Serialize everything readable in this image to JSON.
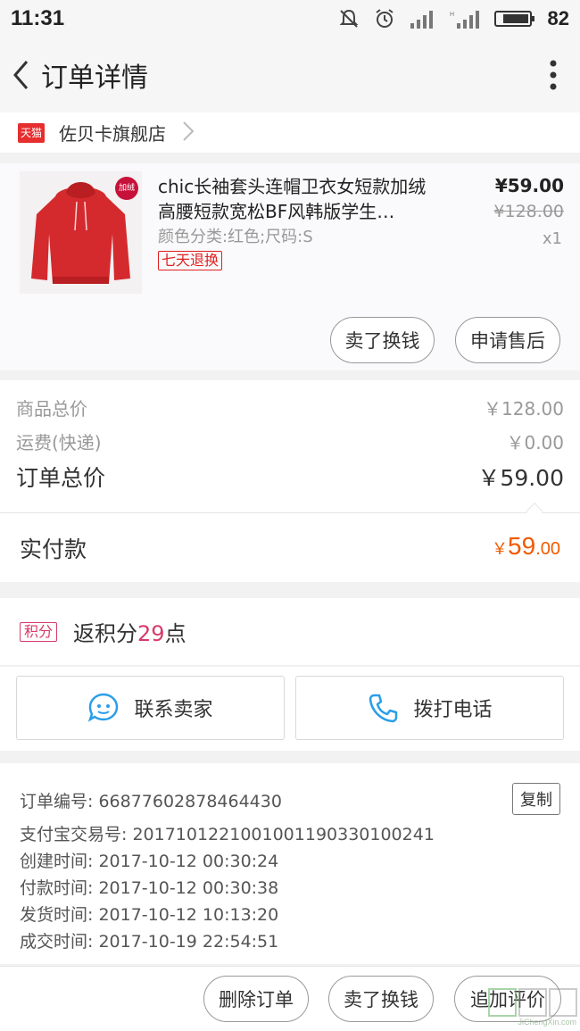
{
  "status_bar": {
    "time": "11:31",
    "battery": "82"
  },
  "nav": {
    "title": "订单详情"
  },
  "store": {
    "badge": "天猫",
    "name": "佐贝卡旗舰店"
  },
  "product": {
    "image_tag": "加绒",
    "title": "chic长袖套头连帽卫衣女短款加绒高腰短款宽松BF风韩版学生…",
    "spec": "颜色分类:红色;尺码:S",
    "return_tag": "七天退换",
    "price": "¥59.00",
    "original_price": "¥128.00",
    "quantity": "x1",
    "actions": {
      "sell": "卖了换钱",
      "after_sale": "申请售后"
    }
  },
  "summary": {
    "goods_label": "商品总价",
    "goods_value": "￥128.00",
    "shipping_label": "运费(快递)",
    "shipping_value": "￥0.00",
    "total_label": "订单总价",
    "total_value": "￥59.00",
    "paid_label": "实付款",
    "paid_currency": "￥",
    "paid_int": "59",
    "paid_dec": ".00"
  },
  "points": {
    "badge": "积分",
    "prefix": "返积分",
    "value": "29",
    "suffix": "点"
  },
  "contact": {
    "seller": "联系卖家",
    "phone": "拨打电话"
  },
  "order_info": {
    "order_no": "订单编号: 66877602878464430",
    "copy": "复制",
    "alipay_no": "支付宝交易号: 2017101221001001190330100241",
    "created": "创建时间: 2017-10-12 00:30:24",
    "paid": "付款时间: 2017-10-12 00:30:38",
    "shipped": "发货时间: 2017-10-12 10:13:20",
    "completed": "成交时间: 2017-10-19 22:54:51"
  },
  "bottom_actions": {
    "delete": "删除订单",
    "sell": "卖了换钱",
    "review": "追加评价"
  },
  "watermark": "JiChengXin.com",
  "colors": {
    "accent_orange": "#f05a00",
    "tmall_red": "#e62e2e",
    "points_pink": "#d73a6a",
    "link_blue": "#2a9ee8"
  }
}
